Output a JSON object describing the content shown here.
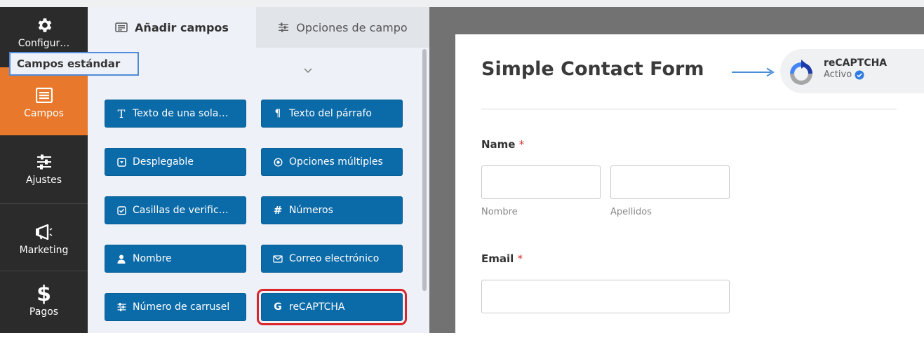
{
  "nav": {
    "items": [
      {
        "label": "Configur…",
        "icon": "gear-icon"
      },
      {
        "label": "Campos",
        "icon": "fields-icon",
        "active": true
      },
      {
        "label": "Ajustes",
        "icon": "sliders-icon"
      },
      {
        "label": "Marketing",
        "icon": "megaphone-icon"
      },
      {
        "label": "Pagos",
        "icon": "dollar-icon"
      }
    ],
    "active_color": "#e8782b"
  },
  "panel": {
    "tabs": {
      "add_fields": "Añadir campos",
      "field_options": "Opciones de campo"
    },
    "section_title": "Campos estándar",
    "fields": [
      {
        "label": "Texto de una sola…",
        "icon": "text-icon"
      },
      {
        "label": "Texto del párrafo",
        "icon": "paragraph-icon"
      },
      {
        "label": "Desplegable",
        "icon": "dropdown-icon"
      },
      {
        "label": "Opciones múltiples",
        "icon": "radio-icon"
      },
      {
        "label": "Casillas de verific…",
        "icon": "checkbox-icon"
      },
      {
        "label": "Números",
        "icon": "hash-icon"
      },
      {
        "label": "Nombre",
        "icon": "user-icon"
      },
      {
        "label": "Correo electrónico",
        "icon": "envelope-icon"
      },
      {
        "label": "Número de carrusel",
        "icon": "sliders-icon"
      },
      {
        "label": "reCAPTCHA",
        "icon": "google-icon",
        "highlighted": true
      }
    ],
    "button_color": "#0b6aa8",
    "highlight_color": "#d9262b"
  },
  "preview": {
    "form_title": "Simple Contact Form",
    "badge": {
      "title": "reCAPTCHA",
      "status": "Activo"
    },
    "name_field": {
      "label": "Name",
      "required_mark": "*",
      "first_sublabel": "Nombre",
      "last_sublabel": "Apellidos",
      "first_value": "",
      "last_value": ""
    },
    "email_field": {
      "label": "Email",
      "required_mark": "*",
      "value": ""
    }
  }
}
